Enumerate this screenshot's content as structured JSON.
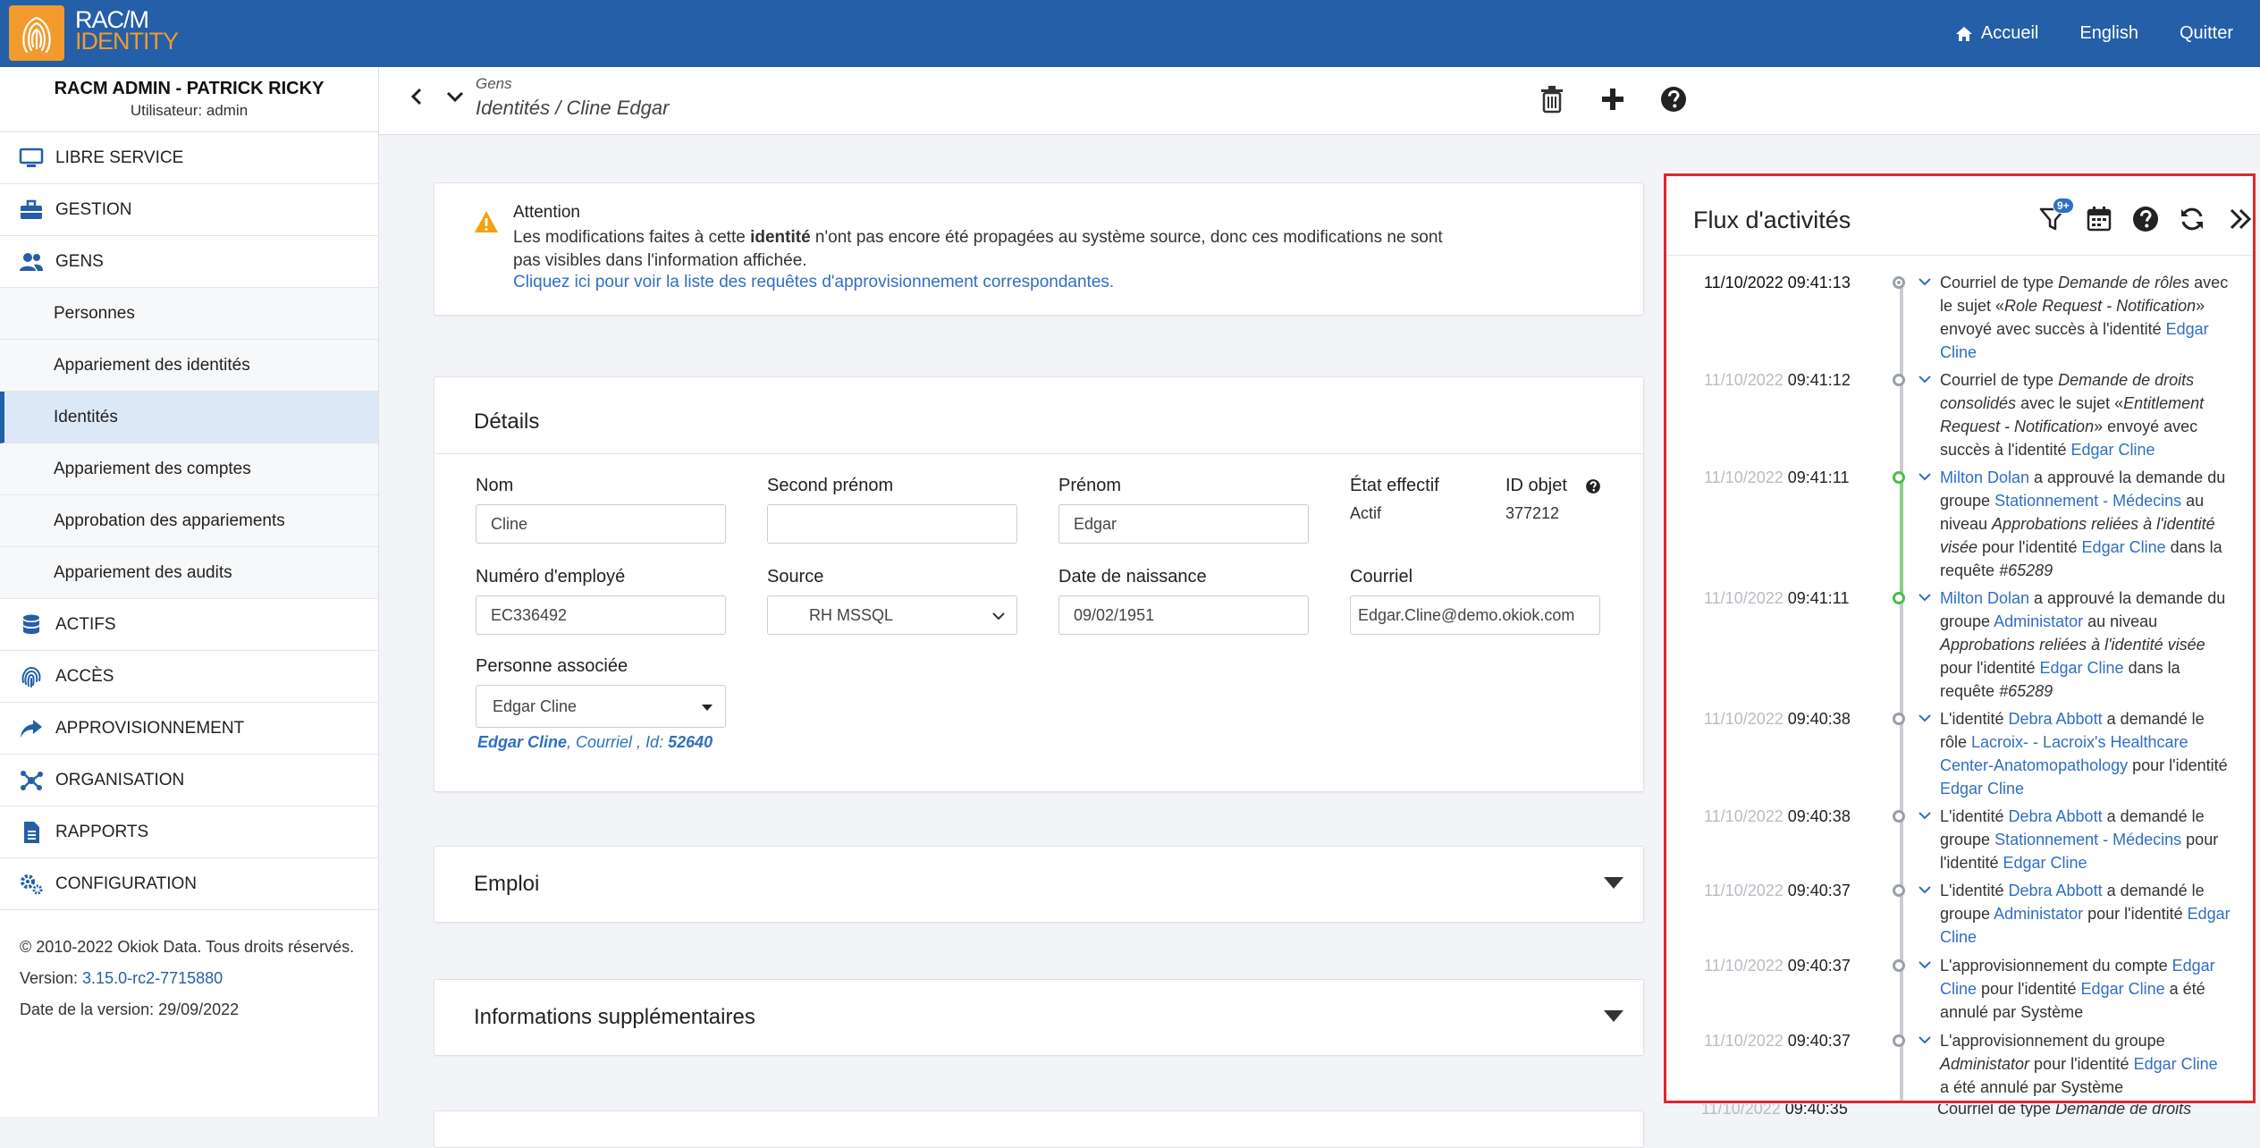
{
  "app": {
    "logo_line1": "RAC/M",
    "logo_line2": "IDENTITY",
    "nav": {
      "home": "Accueil",
      "language": "English",
      "quit": "Quitter"
    }
  },
  "sidebar": {
    "user_name": "RACM ADMIN - PATRICK RICKY",
    "user_role": "Utilisateur: admin",
    "items": {
      "libre": "LIBRE SERVICE",
      "gestion": "GESTION",
      "gens": "GENS",
      "personnes": "Personnes",
      "app_ident": "Appariement des identités",
      "identites": "Identités",
      "app_comptes": "Appariement des comptes",
      "approbation": "Approbation des appariements",
      "app_audits": "Appariement des audits",
      "actifs": "ACTIFS",
      "acces": "ACCÈS",
      "approv": "APPROVISIONNEMENT",
      "organisation": "ORGANISATION",
      "rapports": "RAPPORTS",
      "configuration": "CONFIGURATION"
    },
    "footer": {
      "copyright": "© 2010-2022 Okiok Data. Tous droits réservés.",
      "version_label": "Version: ",
      "version": "3.15.0-rc2-7715880",
      "release_date": "Date de la version: 29/09/2022"
    }
  },
  "header": {
    "breadcrumb_top": "Gens",
    "breadcrumb_main": "Identités / Cline Edgar"
  },
  "alert": {
    "title": "Attention",
    "body_pre": "Les modifications faites à cette ",
    "body_bold": "identité",
    "body_post": " n'ont pas encore été propagées au système source, donc ces modifications ne sont pas visibles dans l'information affichée.",
    "link": "Cliquez ici pour voir la liste des requêtes d'approvisionnement correspondantes."
  },
  "details": {
    "title": "Détails",
    "nom_label": "Nom",
    "nom": "Cline",
    "second_label": "Second prénom",
    "second": "",
    "prenom_label": "Prénom",
    "prenom": "Edgar",
    "etat_label": "État effectif",
    "etat": "Actif",
    "id_label": "ID objet",
    "id": "377212",
    "emp_label": "Numéro d'employé",
    "emp": "EC336492",
    "source_label": "Source",
    "source": "RH MSSQL",
    "dob_label": "Date de naissance",
    "dob": "09/02/1951",
    "email_label": "Courriel",
    "email": "Edgar.Cline@demo.okiok.com",
    "assoc_label": "Personne associée",
    "assoc": "Edgar Cline",
    "assoc_note_name": "Edgar Cline",
    "assoc_note_mid": ", Courriel , Id: ",
    "assoc_note_id": "52640"
  },
  "sections": {
    "emploi": "Emploi",
    "info_sup": "Informations supplémentaires"
  },
  "activity": {
    "title": "Flux d'activités",
    "filter_badge": "9+",
    "entries": [
      {
        "date": "11/10/2022",
        "time": " 09:41:13"
      },
      {
        "date": "11/10/2022",
        "time": " 09:41:12"
      },
      {
        "date": "11/10/2022",
        "time": " 09:41:11"
      },
      {
        "date": "11/10/2022",
        "time": " 09:41:11"
      },
      {
        "date": "11/10/2022",
        "time": " 09:40:38"
      },
      {
        "date": "11/10/2022",
        "time": " 09:40:38"
      },
      {
        "date": "11/10/2022",
        "time": " 09:40:37"
      },
      {
        "date": "11/10/2022",
        "time": " 09:40:37"
      },
      {
        "date": "11/10/2022",
        "time": " 09:40:37"
      },
      {
        "date": "11/10/2022",
        "time": " 09:40:35"
      }
    ],
    "t": {
      "e0a": "Courriel de type ",
      "e0b": "Demande de rôles",
      "e0c": " avec le sujet «",
      "e0d": "Role Request - Notification",
      "e0e": "» envoyé avec succès à l'identité ",
      "e0f": "Edgar Cline",
      "e1a": "Courriel de type ",
      "e1b": "Demande de droits consolidés",
      "e1c": " avec le sujet «",
      "e1d": "Entitlement Request - Notification",
      "e1e": "» envoyé avec succès à l'identité ",
      "e1f": "Edgar Cline",
      "e2a": "Milton Dolan",
      "e2b": " a approuvé la demande du groupe ",
      "e2c": "Stationnement - Médecins",
      "e2d": " au niveau ",
      "e2e": "Approbations reliées à l'identité visée",
      "e2f": " pour l'identité ",
      "e2g": "Edgar Cline",
      "e2h": " dans la requête ",
      "e2i": "#65289",
      "e3a": "Milton Dolan",
      "e3b": " a approuvé la demande du groupe ",
      "e3c": "Administator",
      "e3d": " au niveau ",
      "e3e": "Approbations reliées à l'identité visée",
      "e3f": " pour l'identité ",
      "e3g": "Edgar Cline",
      "e3h": " dans la requête ",
      "e3i": "#65289",
      "e4a": "L'identité ",
      "e4b": "Debra Abbott",
      "e4c": " a demandé le rôle ",
      "e4d": "Lacroix- - Lacroix's Healthcare Center-Anatomopathology",
      "e4e": " pour l'identité ",
      "e4f": "Edgar Cline",
      "e5a": "L'identité ",
      "e5b": "Debra Abbott",
      "e5c": " a demandé le groupe ",
      "e5d": "Stationnement - Médecins",
      "e5e": " pour l'identité ",
      "e5f": "Edgar Cline",
      "e6a": "L'identité ",
      "e6b": "Debra Abbott",
      "e6c": " a demandé le groupe ",
      "e6d": "Administator",
      "e6e": " pour l'identité ",
      "e6f": "Edgar Cline",
      "e7a": "L'approvisionnement du compte ",
      "e7b": "Edgar Cline",
      "e7c": " pour l'identité ",
      "e7d": "Edgar Cline",
      "e7e": " a été annulé par Système",
      "e8a": "L'approvisionnement du groupe ",
      "e8b": "Administator",
      "e8c": " pour l'identité ",
      "e8d": "Edgar Cline",
      "e8e": " a été annulé par Système",
      "e9a": "Courriel de type ",
      "e9b": "Demande de droits"
    }
  },
  "colors": {
    "topbar": "#245fa8",
    "accent": "#f29a2e",
    "link": "#2f6fc3",
    "highlight_border": "#e1262d"
  }
}
